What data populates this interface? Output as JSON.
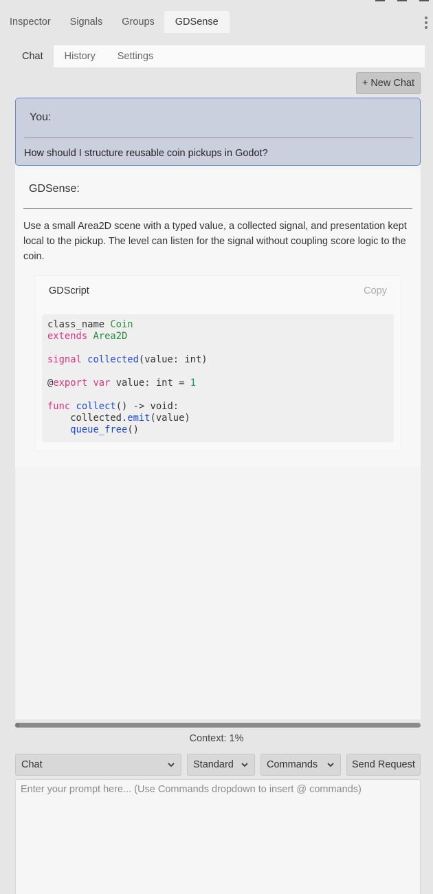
{
  "dock_tabs": [
    "Inspector",
    "Signals",
    "Groups",
    "GDSense"
  ],
  "sub_tabs": [
    "Chat",
    "History",
    "Settings"
  ],
  "new_chat_label": "+ New Chat",
  "user_message": {
    "title": "You:",
    "text": "How should I structure reusable coin pickups in Godot?"
  },
  "assistant_message": {
    "title": "GDSense:",
    "text": "Use a small Area2D scene with a typed value, a collected signal, and presentation kept local to the pickup. The level can listen for the signal without coupling score logic to the coin."
  },
  "code_block": {
    "language": "GDScript",
    "copy_label": "Copy"
  },
  "context_label": "Context: 1%",
  "context_percent": 1,
  "mode_select": "Chat",
  "model_select": "Standard",
  "commands_select": "Commands",
  "send_label": "Send Request",
  "prompt_placeholder": "Enter your prompt here... (Use Commands dropdown to insert @ commands)",
  "colors": {
    "accent_border": "#5f86c9",
    "user_bubble": "#cad0de",
    "keyword": "#d63384",
    "function": "#1f4bd1",
    "number": "#199b46"
  }
}
